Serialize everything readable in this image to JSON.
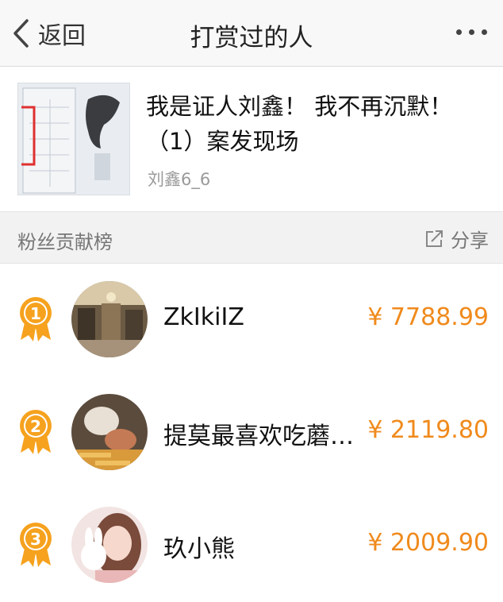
{
  "nav": {
    "back_label": "返回",
    "title": "打赏过的人"
  },
  "article": {
    "title": "我是证人刘鑫！ 我不再沉默！（1）案发现场",
    "author": "刘鑫6_6"
  },
  "section": {
    "title": "粉丝贡献榜",
    "share_label": "分享"
  },
  "ranking": [
    {
      "rank": "1",
      "name": "ZkIkiIZ",
      "amount": "¥ 7788.99"
    },
    {
      "rank": "2",
      "name": "提莫最喜欢吃蘑…",
      "amount": "¥ 2119.80"
    },
    {
      "rank": "3",
      "name": "玖小熊",
      "amount": "¥ 2009.90"
    }
  ],
  "colors": {
    "accent": "#f08a1c",
    "medal": "#f6a21e",
    "navbar_bg": "#f8f8f8",
    "section_bg": "#f2f2f2"
  }
}
